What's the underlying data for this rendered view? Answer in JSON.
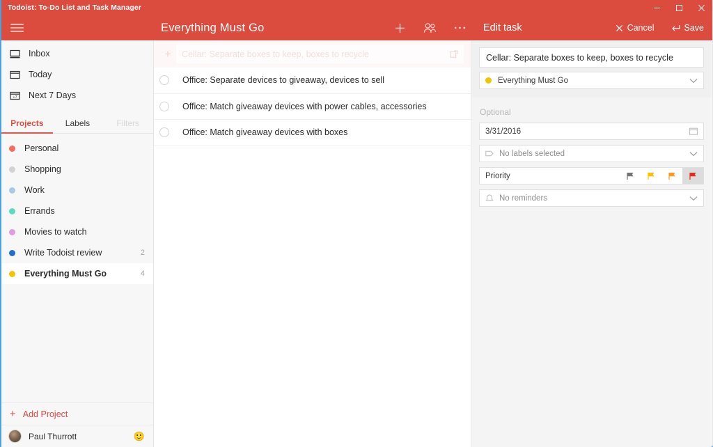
{
  "window": {
    "title": "Todoist: To-Do List and Task Manager",
    "controls": [
      {
        "name": "minimize",
        "glyph": "minimize-icon"
      },
      {
        "name": "maximize",
        "glyph": "maximize-icon"
      },
      {
        "name": "close",
        "glyph": "close-icon"
      }
    ]
  },
  "colors": {
    "brand_red": "#db4c3f",
    "accent_link": "#db4c3f",
    "sidebar_bg": "#f7f7f7",
    "panel_bg": "#f4f4f4",
    "selected_bg": "#ffffff",
    "window_border_blue": "#4aa3df"
  },
  "header": {
    "menu_icon": "hamburger-icon",
    "project_title": "Everything Must Go",
    "actions": [
      {
        "name": "add-task",
        "icon": "plus-icon"
      },
      {
        "name": "share-project",
        "icon": "people-icon"
      },
      {
        "name": "more-options",
        "icon": "ellipsis-icon"
      }
    ]
  },
  "edit_header": {
    "title": "Edit task",
    "cancel_label": "Cancel",
    "cancel_icon": "close-icon",
    "save_label": "Save",
    "save_icon": "enter-arrow-icon"
  },
  "sidebar": {
    "nav": [
      {
        "label": "Inbox",
        "icon": "inbox-icon"
      },
      {
        "label": "Today",
        "icon": "calendar-icon"
      },
      {
        "label": "Next 7 Days",
        "icon": "calendar-7-icon"
      }
    ],
    "tabs": [
      {
        "label": "Projects",
        "state": "active"
      },
      {
        "label": "Labels",
        "state": "normal"
      },
      {
        "label": "Filters",
        "state": "dim"
      }
    ],
    "projects": [
      {
        "label": "Personal",
        "color": "#f76b5e",
        "count": "",
        "selected": false
      },
      {
        "label": "Shopping",
        "color": "#d2d2d2",
        "count": "",
        "selected": false
      },
      {
        "label": "Work",
        "color": "#a8c9e5",
        "count": "",
        "selected": false
      },
      {
        "label": "Errands",
        "color": "#5ddbc0",
        "count": "",
        "selected": false
      },
      {
        "label": "Movies to watch",
        "color": "#e39ae0",
        "count": "",
        "selected": false
      },
      {
        "label": "Write Todoist review",
        "color": "#1f6fd0",
        "count": "2",
        "selected": false
      },
      {
        "label": "Everything Must Go",
        "color": "#f5c400",
        "count": "4",
        "selected": true
      }
    ],
    "add_project": {
      "label": "Add Project",
      "icon": "plus-icon"
    },
    "user": {
      "name": "Paul Thurrott",
      "avatar": "avatar",
      "status_emoji": "🙂"
    }
  },
  "tasklist": {
    "add_task": {
      "placeholder": "Cellar: Separate boxes to keep, boxes to recycle",
      "plus_icon": "plus-icon",
      "expand_icon": "open-external-icon"
    },
    "tasks": [
      {
        "text": "Office: Separate devices to giveaway, devices to sell",
        "checked": false
      },
      {
        "text": "Office: Match giveaway devices with power cables, accessories",
        "checked": false
      },
      {
        "text": "Office: Match giveaway devices with boxes",
        "checked": false
      }
    ]
  },
  "edit_panel": {
    "task_title": "Cellar: Separate boxes to keep, boxes to recycle",
    "project": {
      "label": "Everything Must Go",
      "color": "#f5c400"
    },
    "optional_label": "Optional",
    "due_date": {
      "value": "3/31/2016",
      "icon": "calendar-icon"
    },
    "labels": {
      "value": "No labels selected",
      "icon": "tag-icon"
    },
    "priority": {
      "label": "Priority",
      "flags": [
        {
          "name": "priority-4",
          "color": "#757575",
          "selected": false
        },
        {
          "name": "priority-3",
          "color": "#fcc000",
          "selected": false
        },
        {
          "name": "priority-2",
          "color": "#ff9a1f",
          "selected": false
        },
        {
          "name": "priority-1",
          "color": "#e02b1d",
          "selected": true
        }
      ]
    },
    "reminders": {
      "value": "No reminders",
      "icon": "bell-icon"
    }
  }
}
